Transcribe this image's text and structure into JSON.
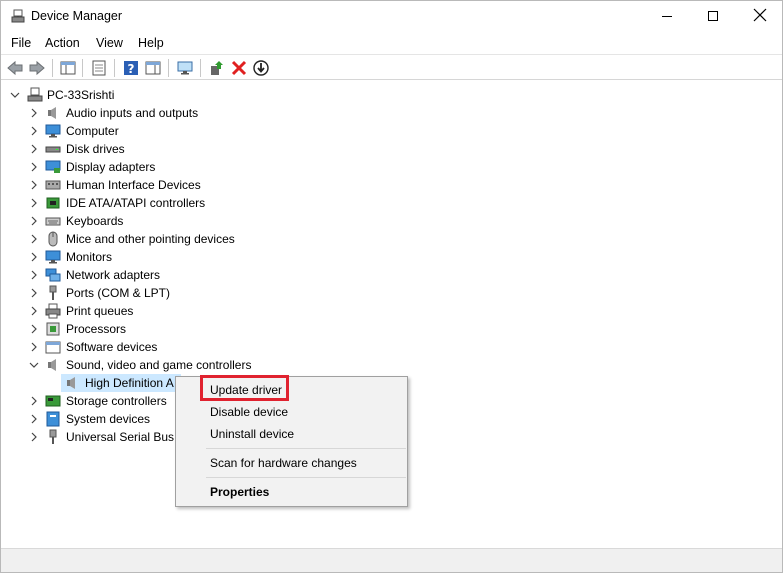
{
  "window": {
    "title": "Device Manager",
    "icon": "device-manager-icon"
  },
  "menu": [
    "File",
    "Action",
    "View",
    "Help"
  ],
  "toolbar": {
    "icons": [
      "back-arrow-icon",
      "forward-arrow-icon",
      "show-hide-console-tree-icon",
      "properties-icon",
      "help-icon",
      "action-pane-icon",
      "monitor-scan-icon",
      "update-driver-icon",
      "uninstall-device-icon",
      "disable-device-icon"
    ],
    "colors": {
      "uninstall": "#e02020",
      "update": "#2f9a2f"
    }
  },
  "tree": {
    "root": {
      "label": "PC-33Srishti",
      "expanded": true
    },
    "categories": [
      {
        "label": "Audio inputs and outputs",
        "icon": "speaker-icon",
        "expanded": false
      },
      {
        "label": "Computer",
        "icon": "computer-icon",
        "expanded": false
      },
      {
        "label": "Disk drives",
        "icon": "disk-drive-icon",
        "expanded": false
      },
      {
        "label": "Display adapters",
        "icon": "display-adapter-icon",
        "expanded": false
      },
      {
        "label": "Human Interface Devices",
        "icon": "hid-icon",
        "expanded": false
      },
      {
        "label": "IDE ATA/ATAPI controllers",
        "icon": "ide-controller-icon",
        "expanded": false
      },
      {
        "label": "Keyboards",
        "icon": "keyboard-icon",
        "expanded": false
      },
      {
        "label": "Mice and other pointing devices",
        "icon": "mouse-icon",
        "expanded": false
      },
      {
        "label": "Monitors",
        "icon": "monitor-icon",
        "expanded": false
      },
      {
        "label": "Network adapters",
        "icon": "network-adapter-icon",
        "expanded": false
      },
      {
        "label": "Ports (COM & LPT)",
        "icon": "port-icon",
        "expanded": false
      },
      {
        "label": "Print queues",
        "icon": "printer-icon",
        "expanded": false
      },
      {
        "label": "Processors",
        "icon": "processor-icon",
        "expanded": false
      },
      {
        "label": "Software devices",
        "icon": "software-device-icon",
        "expanded": false
      },
      {
        "label": "Sound, video and game controllers",
        "icon": "speaker-icon",
        "expanded": true
      },
      {
        "label": "Storage controllers",
        "icon": "storage-controller-icon",
        "expanded": false
      },
      {
        "label": "System devices",
        "icon": "system-device-icon",
        "expanded": false
      },
      {
        "label": "Universal Serial Bus c",
        "icon": "usb-icon",
        "expanded": false
      }
    ],
    "child_selected": {
      "label": "High Definition A",
      "icon": "speaker-icon"
    }
  },
  "context_menu": {
    "items": [
      "Update driver",
      "Disable device",
      "Uninstall device",
      "Scan for hardware changes",
      "Properties"
    ],
    "highlight_color": "#e0222f"
  }
}
